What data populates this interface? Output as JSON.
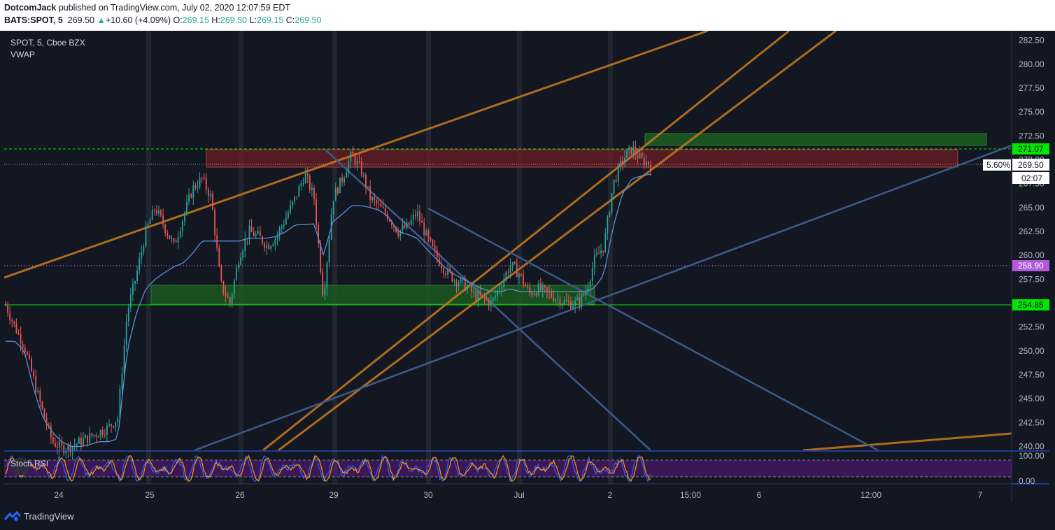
{
  "header": {
    "author": "DotcomJack",
    "published": "published on TradingView.com, July 02, 2020 12:07:59 EDT",
    "symbol": "BATS:SPOT, 5",
    "last": "269.50",
    "change_arrow": "▲",
    "change": "+10.60 (+4.09%)",
    "o_label": "O:",
    "o": "269.15",
    "h_label": "H:",
    "h": "269.50",
    "l_label": "L:",
    "l": "269.15",
    "c_label": "C:",
    "c": "269.50"
  },
  "legend": {
    "title": "SPOT, 5, Cboe BZX",
    "indicator": "VWAP",
    "stoch_label": "Stoch RSI"
  },
  "price_labels": {
    "resistance": "271.07",
    "current": "269.50",
    "percent": "5.60%",
    "countdown": "02:07",
    "mid": "258.90",
    "support": "254.85"
  },
  "colors": {
    "background": "#131722",
    "up": "#26a69a",
    "down": "#ef5350",
    "orange": "#c87a1e",
    "blue": "#3d5a8a",
    "green_zone": "#1b5e20",
    "red_zone": "#6b1e24",
    "lime": "#00e600",
    "magenta": "#b05ad8",
    "vwap": "#5b8fd4",
    "stoch_k": "#2962ff",
    "stoch_d": "#ff9800"
  },
  "footer": {
    "brand": "TradingView",
    "logo": "tradingview-logo-icon"
  },
  "chart_data": {
    "type": "candlestick",
    "title": "SPOT, 5, Cboe BZX",
    "ylim": [
      239.6,
      283.5
    ],
    "y_ticks": [
      "282.50",
      "280.00",
      "277.50",
      "275.00",
      "272.50",
      "270.00",
      "267.50",
      "265.00",
      "262.50",
      "260.00",
      "257.50",
      "255.00",
      "252.50",
      "250.00",
      "247.50",
      "245.00",
      "242.50",
      "240.00"
    ],
    "x_ticks": [
      "24",
      "25",
      "26",
      "29",
      "30",
      "Jul",
      "2",
      "15:00",
      "6",
      "12:00",
      "7"
    ],
    "stoch_ticks": [
      "100.00",
      "0.00"
    ],
    "price_path": [
      254.8,
      252.5,
      250.5,
      247,
      243.5,
      240.5,
      239.8,
      240,
      240.5,
      241,
      241.5,
      242,
      243,
      254,
      258,
      262.5,
      265,
      263,
      261,
      264,
      267,
      268,
      266,
      257,
      255,
      260,
      262.5,
      262,
      261,
      262,
      264,
      266,
      268.5,
      266,
      255.5,
      266,
      268,
      270.5,
      269,
      266,
      265,
      264,
      262.5,
      263,
      264.5,
      262,
      260,
      258.5,
      257.5,
      257,
      256,
      255.5,
      255,
      257,
      259,
      258,
      256,
      256.5,
      256,
      255.5,
      255,
      255,
      256,
      259.5,
      261,
      267.5,
      270,
      271.2,
      270,
      269.5
    ],
    "vwap_path": [
      251,
      251,
      250,
      246,
      243,
      241.5,
      240.5,
      240,
      240,
      240.2,
      240.5,
      240.5,
      240.8,
      250,
      254,
      256.5,
      257.5,
      258.2,
      258.8,
      259.2,
      260.2,
      261.5,
      261.5,
      261.5,
      261.5,
      261.5,
      261.8,
      261.8,
      261.8,
      262,
      262.5,
      263.2,
      263.2,
      263.3,
      260,
      263.5,
      264.3,
      265.2,
      265.2,
      265,
      264.7,
      264,
      262.5,
      262.2,
      261.8,
      260.7,
      259.7,
      258.7,
      258,
      257.5,
      257,
      256.5,
      256.2,
      256.2,
      256.5,
      256.2,
      256.2,
      256.2,
      256.2,
      256.2,
      256.2,
      256.2,
      256.2,
      256.6,
      258,
      263,
      266.5,
      268,
      268.3,
      268.5
    ]
  }
}
